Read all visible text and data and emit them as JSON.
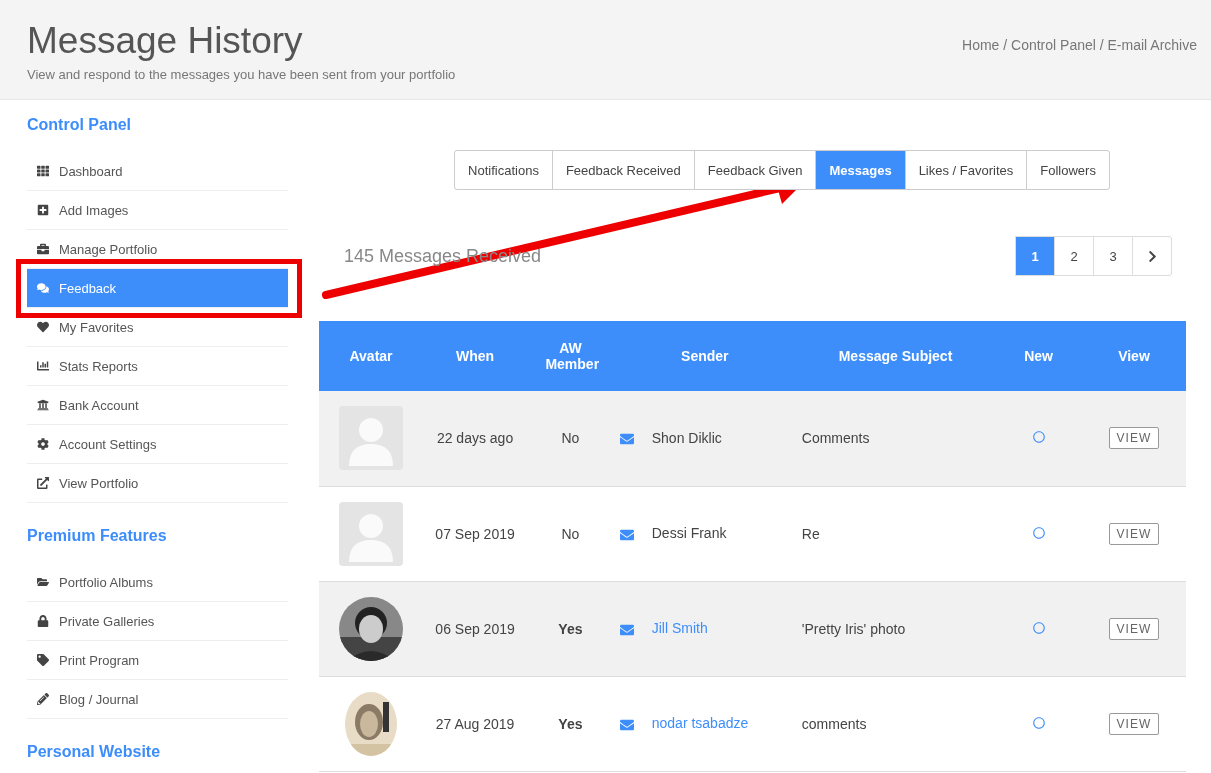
{
  "header": {
    "title": "Message History",
    "subtitle": "View and respond to the messages you have been sent from your portfolio",
    "breadcrumb": "Home / Control Panel / E-mail Archive"
  },
  "sidebar": {
    "sections": [
      {
        "title": "Control Panel",
        "items": [
          {
            "label": "Dashboard",
            "selected": false
          },
          {
            "label": "Add Images",
            "selected": false
          },
          {
            "label": "Manage Portfolio",
            "selected": false
          },
          {
            "label": "Feedback",
            "selected": true
          },
          {
            "label": "My Favorites",
            "selected": false
          },
          {
            "label": "Stats Reports",
            "selected": false
          },
          {
            "label": "Bank Account",
            "selected": false
          },
          {
            "label": "Account Settings",
            "selected": false
          },
          {
            "label": "View Portfolio",
            "selected": false
          }
        ]
      },
      {
        "title": "Premium Features",
        "items": [
          {
            "label": "Portfolio Albums",
            "selected": false
          },
          {
            "label": "Private Galleries",
            "selected": false
          },
          {
            "label": "Print Program",
            "selected": false
          },
          {
            "label": "Blog / Journal",
            "selected": false
          }
        ]
      },
      {
        "title": "Personal Website"
      }
    ]
  },
  "tabs": [
    {
      "label": "Notifications",
      "selected": false
    },
    {
      "label": "Feedback Received",
      "selected": false
    },
    {
      "label": "Feedback Given",
      "selected": false
    },
    {
      "label": "Messages",
      "selected": true
    },
    {
      "label": "Likes / Favorites",
      "selected": false
    },
    {
      "label": "Followers",
      "selected": false
    }
  ],
  "count": "145 Messages Received",
  "pagination": [
    {
      "label": "1",
      "selected": true
    },
    {
      "label": "2",
      "selected": false
    },
    {
      "label": "3",
      "selected": false
    }
  ],
  "table": {
    "columns": [
      "Avatar",
      "When",
      "AW Member",
      "Sender",
      "Message Subject",
      "New",
      "View"
    ],
    "rows": [
      {
        "kind": "placeholder",
        "when": "22 days ago",
        "member_label": "No",
        "member": false,
        "sender": "Shon Diklic",
        "subject": "Comments",
        "action": "VIEW"
      },
      {
        "kind": "placeholder",
        "when": "07 Sep 2019",
        "member_label": "No",
        "member": false,
        "sender": "Dessi Frank",
        "subject": "Re",
        "action": "VIEW"
      },
      {
        "when": "06 Sep 2019",
        "member_label": "Yes",
        "member": true,
        "sender": "Jill Smith",
        "subject": "'Pretty Iris' photo",
        "action": "VIEW"
      },
      {
        "kind": "sketch",
        "when": "27 Aug 2019",
        "member_label": "Yes",
        "member": true,
        "sender": "nodar tsabadze",
        "subject": "comments",
        "action": "VIEW"
      }
    ]
  }
}
